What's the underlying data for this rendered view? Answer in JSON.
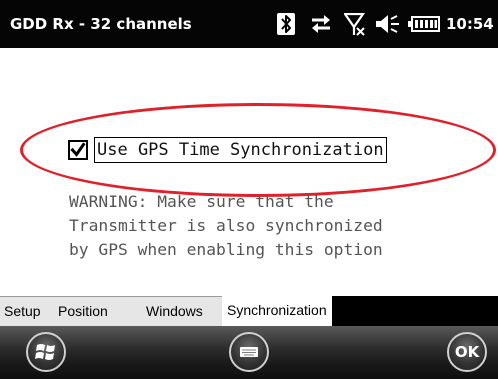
{
  "title_bar": {
    "app_title": "GDD Rx - 32 channels",
    "clock": "10:54",
    "icons": [
      "bluetooth-icon",
      "data-transfer-icon",
      "signal-off-icon",
      "volume-icon",
      "battery-icon"
    ]
  },
  "content": {
    "gps_sync": {
      "label": "Use GPS Time Synchronization",
      "checked": true
    },
    "warning_lines": [
      "WARNING: Make sure that the",
      "Transmitter is also synchronized",
      "by GPS when enabling this option"
    ],
    "highlight_color": "#e0202a"
  },
  "tabs": [
    {
      "label": "Setup",
      "active": false
    },
    {
      "label": "Position",
      "active": false
    },
    {
      "label": "Windows",
      "active": false
    },
    {
      "label": "Synchronization",
      "active": true
    }
  ],
  "softkeys": {
    "left": "windows-start-icon",
    "center": "keyboard-icon",
    "right_label": "OK"
  }
}
